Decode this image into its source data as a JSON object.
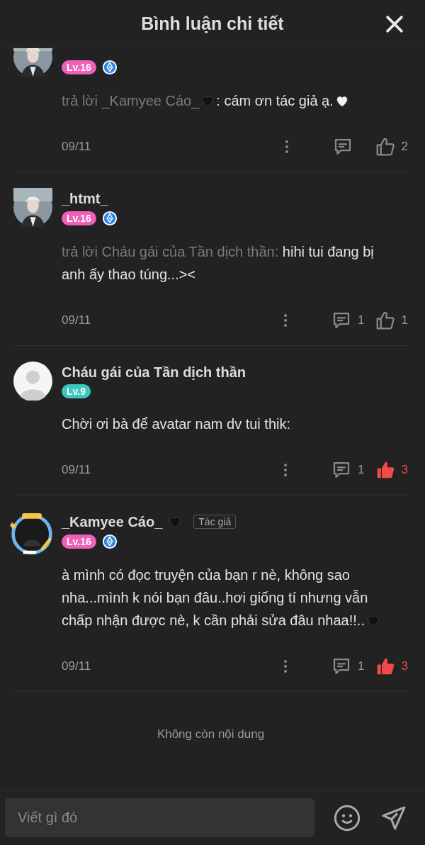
{
  "header": {
    "title": "Bình luận chi tiết"
  },
  "comments": [
    {
      "level": {
        "label": "Lv.16",
        "color": "#f060b8"
      },
      "badge": true,
      "body": [
        {
          "kind": "reply",
          "text": "trả lời _Kamyee Cáo_"
        },
        {
          "kind": "heart",
          "color": "#111111"
        },
        {
          "kind": "text",
          "text": ": cám ơn tác giả ạ."
        },
        {
          "kind": "heart",
          "color": "#f2f2f2"
        }
      ],
      "date": "09/11",
      "likes": "2",
      "liked": false
    },
    {
      "name": "_htmt_",
      "level": {
        "label": "Lv.16",
        "color": "#f060b8"
      },
      "badge": true,
      "body": [
        {
          "kind": "reply",
          "text": "trả lời Cháu gái của Tần dịch thần:"
        },
        {
          "kind": "text",
          "text": " hihi tui đang bị anh ấy thao túng...><"
        }
      ],
      "date": "09/11",
      "replies": "1",
      "likes": "1",
      "liked": false
    },
    {
      "avatar": {
        "kind": "default"
      },
      "name": "Cháu gái của Tần dịch thần",
      "level": {
        "label": "Lv.9",
        "color": "#3cc6c0"
      },
      "badge": false,
      "body": [
        {
          "kind": "text",
          "text": "Chời ơi bà để avatar nam dv tui thik:"
        }
      ],
      "date": "09/11",
      "replies": "1",
      "likes": "3",
      "liked": true
    },
    {
      "avatar": {
        "kind": "framed"
      },
      "name": "_Kamyee Cáo_",
      "name_heart": {
        "color": "#111111"
      },
      "level": {
        "label": "Lv.16",
        "color": "#f060b8"
      },
      "badge": true,
      "author_tag": "Tác giả",
      "body": [
        {
          "kind": "text",
          "text": "à mình có đọc truyện của bạn r nè, không sao nha...mình k nói bạn đâu..hơi giống tí nhưng vẫn chấp nhận được nè, k cần phải sửa đâu nhaa!!.."
        },
        {
          "kind": "heart",
          "color": "#111111"
        }
      ],
      "date": "09/11",
      "replies": "1",
      "likes": "3",
      "liked": true
    }
  ],
  "end_text": "Không còn nội dung",
  "composer": {
    "placeholder": "Viết gì đó"
  }
}
